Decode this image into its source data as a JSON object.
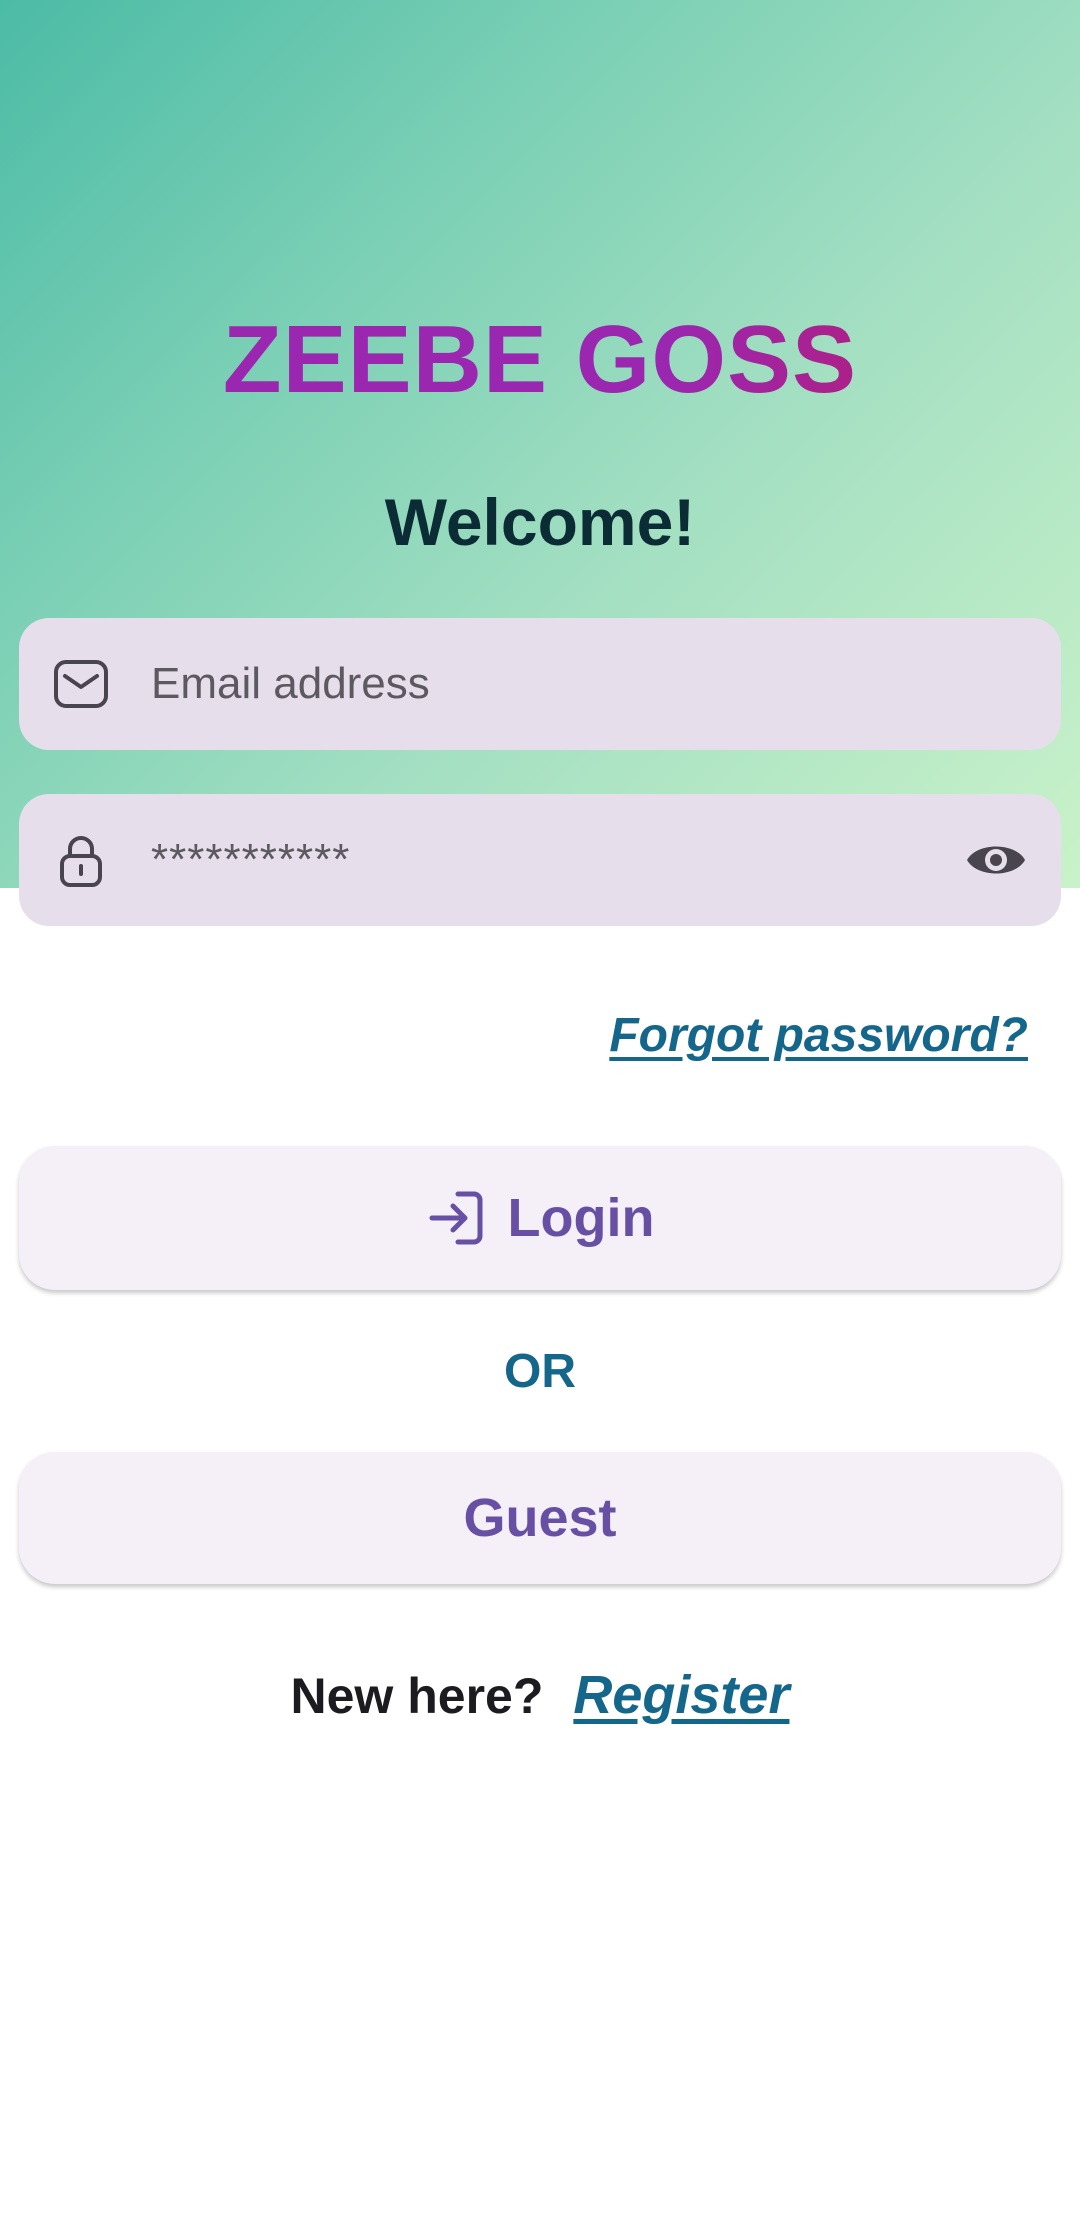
{
  "brand": {
    "title": "ZEEBE GOSS"
  },
  "header": {
    "welcome": "Welcome!"
  },
  "form": {
    "email": {
      "placeholder": "Email address",
      "value": "",
      "icon": "mail-icon"
    },
    "password": {
      "masked_value": "***********",
      "icon": "lock-icon",
      "toggle_icon": "eye-icon"
    },
    "forgot_password": "Forgot password?"
  },
  "actions": {
    "login_label": "Login",
    "login_icon": "login-arrow-icon",
    "or_label": "OR",
    "guest_label": "Guest"
  },
  "footer": {
    "prompt": "New here?",
    "register_label": "Register"
  },
  "colors": {
    "brand_gradient_start": "#9b27b0",
    "brand_gradient_end": "#c2185b",
    "link": "#14668a",
    "button_text": "#6750a4",
    "field_bg": "#e6dfeb",
    "button_bg": "#f5eff7"
  }
}
